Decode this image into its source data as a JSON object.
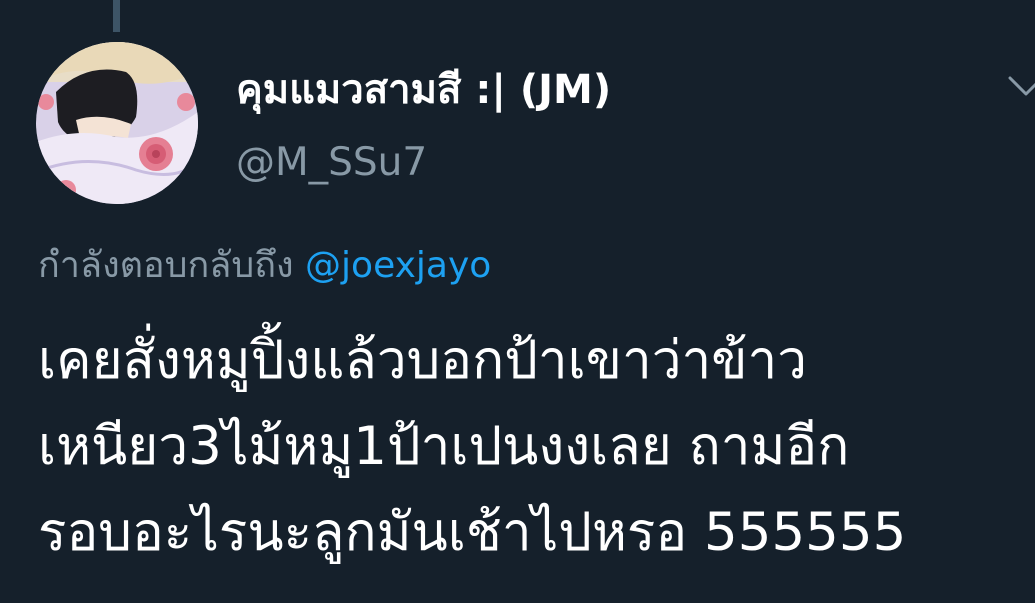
{
  "tweet": {
    "author": {
      "display_name": "คุมแมวสามสี :| (JM)",
      "handle": "@M_SSu7",
      "avatar_icon": "profile-avatar-anime-girl-roses"
    },
    "reply_context": {
      "prefix": "กำลังตอบกลับถึง",
      "mention": "@joexjayo"
    },
    "text_lines": [
      "เคยสั่งหมูปิ้งแล้วบอกป้าเขาว่าข้าว",
      "เหนียว3ไม้หมู1ป้าเปนงงเลย ถามอีก",
      "รอบอะไรนะลูกมันเช้าไปหรอ 555555"
    ],
    "menu_icon": "chevron-down-icon"
  },
  "colors": {
    "background": "#15202b",
    "text_primary": "#ffffff",
    "text_secondary": "#8899a6",
    "accent": "#1da1f2",
    "thread_line": "#3d5466"
  }
}
